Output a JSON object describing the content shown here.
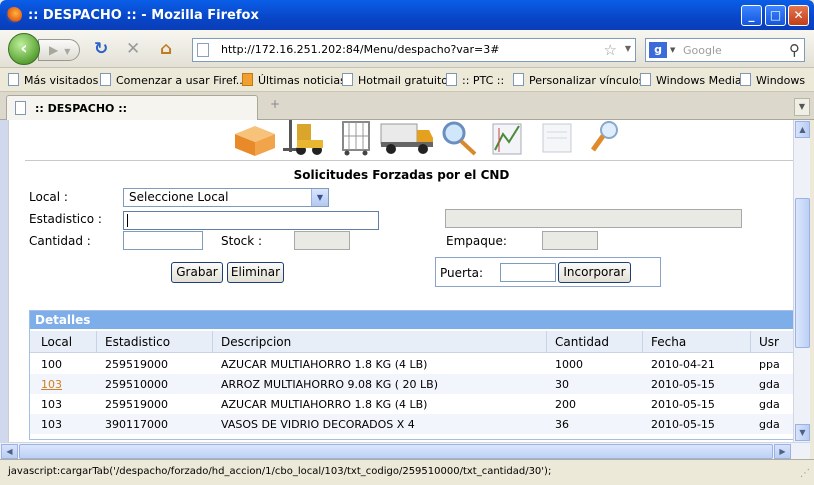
{
  "window": {
    "title": ":: DESPACHO :: - Mozilla Firefox"
  },
  "nav": {
    "url": "http://172.16.251.202:84/Menu/despacho?var=3#",
    "search_placeholder": "Google"
  },
  "bookmarks": [
    "Más visitados",
    "Comenzar a usar Firef...",
    "Últimas noticias",
    "Hotmail gratuito",
    ":: PTC ::",
    "Personalizar vínculos",
    "Windows Media",
    "Windows"
  ],
  "tab": {
    "label": ":: DESPACHO ::"
  },
  "form": {
    "title": "Solicitudes Forzadas por el CND",
    "local_label": "Local :",
    "local_value": "Seleccione Local",
    "estadistico_label": "Estadistico :",
    "cantidad_label": "Cantidad :",
    "stock_label": "Stock :",
    "empaque_label": "Empaque:",
    "grabar_label": "Grabar",
    "eliminar_label": "Eliminar",
    "puerta_label": "Puerta:",
    "incorporar_label": "Incorporar"
  },
  "details": {
    "title": "Detalles",
    "columns": [
      "Local",
      "Estadistico",
      "Descripcion",
      "Cantidad",
      "Fecha",
      "Usr"
    ],
    "rows": [
      [
        "100",
        "259519000",
        "AZUCAR MULTIAHORRO 1.8 KG (4 LB)",
        "1000",
        "2010-04-21",
        "ppa"
      ],
      [
        "103",
        "259510000",
        "ARROZ MULTIAHORRO 9.08 KG ( 20 LB)",
        "30",
        "2010-05-15",
        "gda"
      ],
      [
        "103",
        "259519000",
        "AZUCAR MULTIAHORRO 1.8 KG (4 LB)",
        "200",
        "2010-05-15",
        "gda"
      ],
      [
        "103",
        "390117000",
        "VASOS DE VIDRIO DECORADOS X 4",
        "36",
        "2010-05-15",
        "gda"
      ]
    ]
  },
  "status": {
    "text": "javascript:cargarTab('/despacho/forzado/hd_accion/1/cbo_local/103/txt_codigo/259510000/txt_cantidad/30');"
  },
  "icons": {
    "toolbar_icons": [
      "boxes-icon",
      "forklift-icon",
      "cage-cart-icon",
      "truck-icon",
      "magnifier-icon",
      "chart-icon",
      "document-icon",
      "zoom-tool-icon"
    ]
  },
  "colors": {
    "details_header": "#7eaeea",
    "link": "#d08020",
    "titlebar": "#0846c8"
  }
}
